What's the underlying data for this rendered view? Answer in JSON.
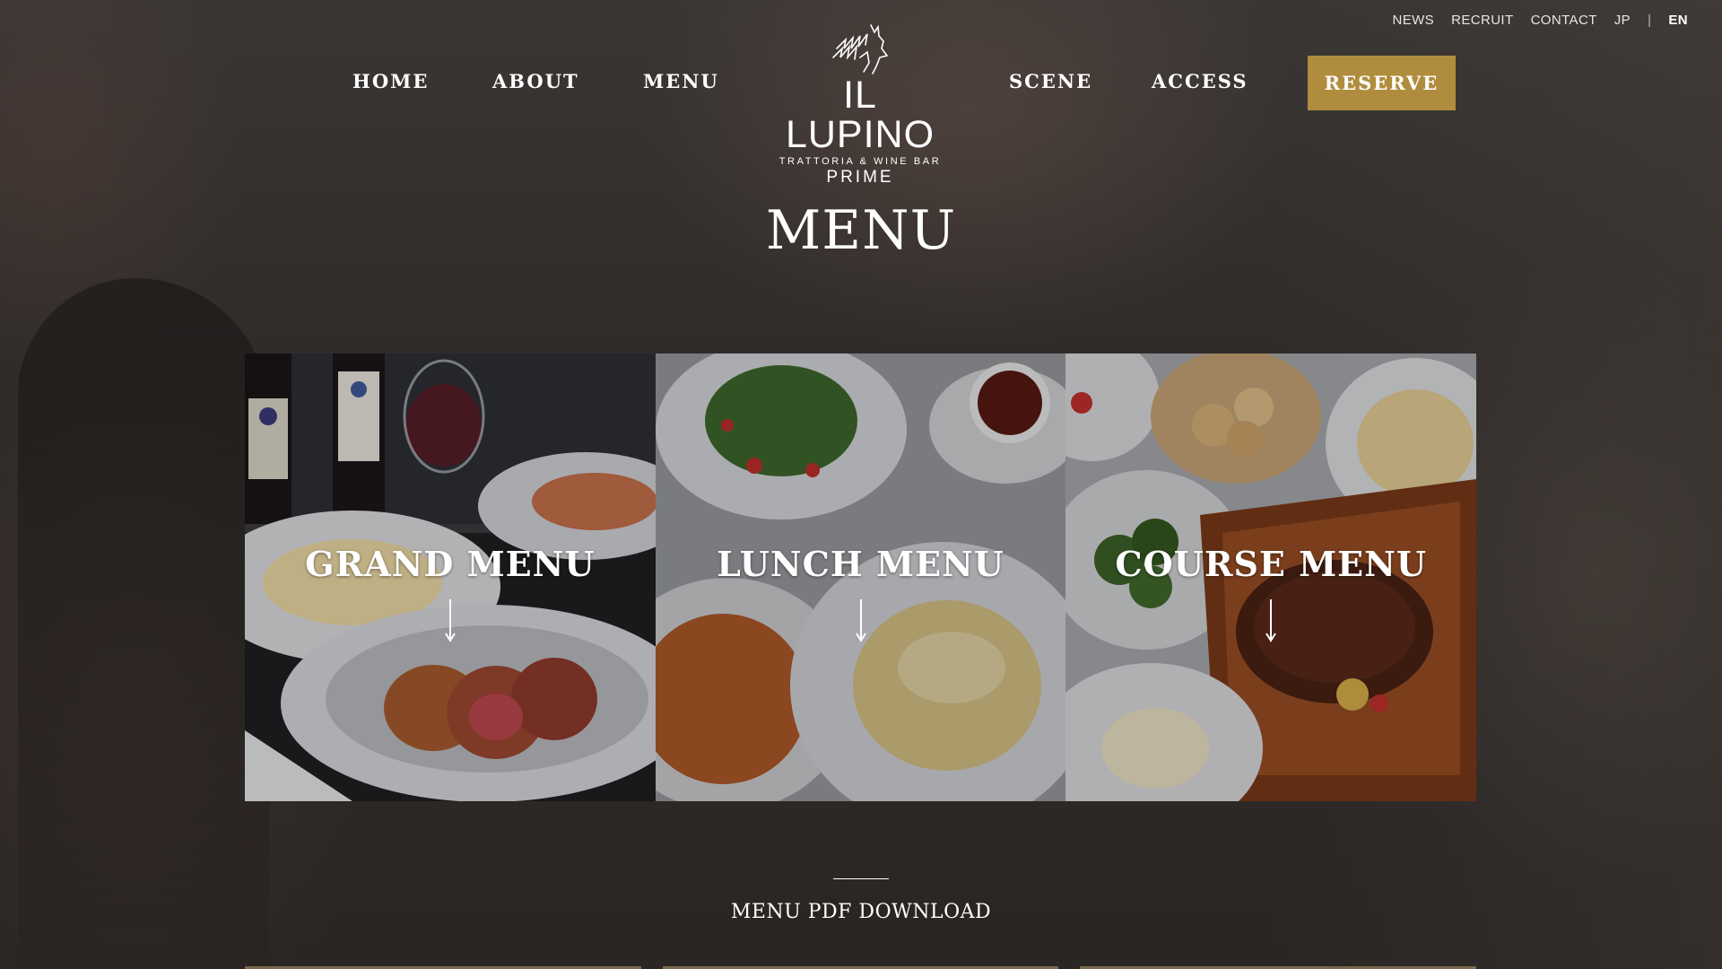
{
  "utility_nav": {
    "news": "NEWS",
    "recruit": "RECRUIT",
    "contact": "CONTACT",
    "jp": "JP",
    "separator": "|",
    "en": "EN"
  },
  "main_nav": {
    "home": "HOME",
    "about": "ABOUT",
    "menu": "MENU",
    "scene": "SCENE",
    "access": "ACCESS",
    "reserve": "RESERVE"
  },
  "logo": {
    "name": "IL LUPINO",
    "subtitle": "TRATTORIA & WINE BAR",
    "tagline": "PRIME",
    "icon": "wolf-icon"
  },
  "page_title": "MENU",
  "menu_cards": [
    {
      "label": "GRAND MENU",
      "icon": "arrow-down-icon"
    },
    {
      "label": "LUNCH MENU",
      "icon": "arrow-down-icon"
    },
    {
      "label": "COURSE MENU",
      "icon": "arrow-down-icon"
    }
  ],
  "pdf_download": "MENU PDF DOWNLOAD",
  "colors": {
    "accent": "#b08d3e",
    "background": "#2a2725",
    "text": "#ffffff"
  }
}
